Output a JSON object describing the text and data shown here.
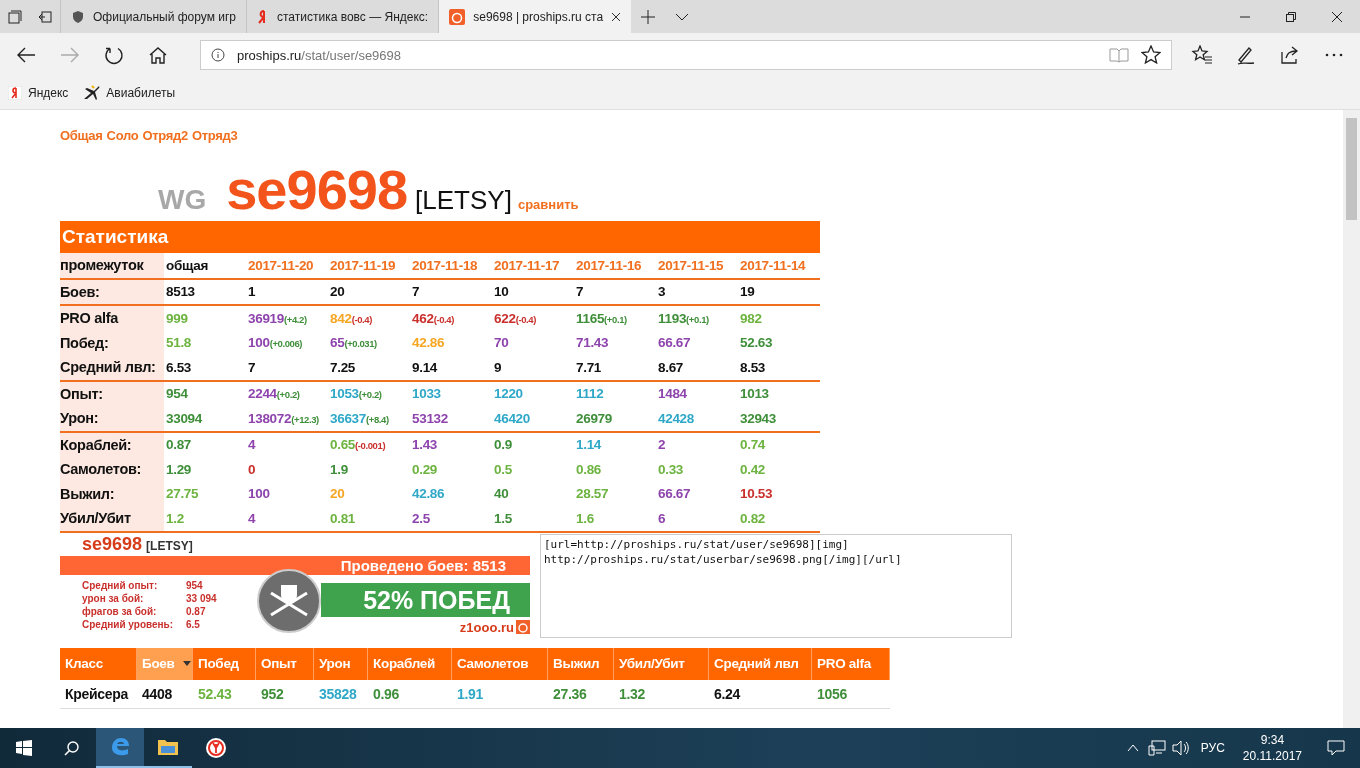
{
  "browser": {
    "tabs": [
      {
        "title": "Официальный форум игр",
        "selected": false
      },
      {
        "title": "статистика вовс — Яндекс:",
        "selected": false
      },
      {
        "title": "se9698 | proships.ru ста",
        "selected": true
      }
    ],
    "address": {
      "host": "proships.ru",
      "path": "/stat/user/se9698"
    },
    "bookmarks": [
      {
        "label": "Яндекс"
      },
      {
        "label": "Авиабилеты"
      }
    ]
  },
  "modes": [
    "Общая",
    "Соло",
    "Отряд2",
    "Отряд3"
  ],
  "player": {
    "prefix": "WG",
    "name": "se9698",
    "clan": "[LETSY]",
    "compare": "сравнить"
  },
  "stats": {
    "title": "Статистика",
    "header_label": "промежуток",
    "columns": [
      {
        "text": "общая",
        "color": "#111111"
      },
      {
        "text": "2017-11-20",
        "color": "#f07020"
      },
      {
        "text": "2017-11-19",
        "color": "#f07020"
      },
      {
        "text": "2017-11-18",
        "color": "#f07020"
      },
      {
        "text": "2017-11-17",
        "color": "#f07020"
      },
      {
        "text": "2017-11-16",
        "color": "#f07020"
      },
      {
        "text": "2017-11-15",
        "color": "#f07020"
      },
      {
        "text": "2017-11-14",
        "color": "#f07020"
      }
    ],
    "groups": [
      {
        "rows": [
          {
            "label": "Боев:",
            "cells": [
              {
                "value": "8513",
                "color": "#111111"
              },
              {
                "value": "1",
                "color": "#111111"
              },
              {
                "value": "20",
                "color": "#111111"
              },
              {
                "value": "7",
                "color": "#111111"
              },
              {
                "value": "10",
                "color": "#111111"
              },
              {
                "value": "7",
                "color": "#111111"
              },
              {
                "value": "3",
                "color": "#111111"
              },
              {
                "value": "19",
                "color": "#111111"
              }
            ]
          }
        ]
      },
      {
        "rows": [
          {
            "label": "PRO alfa",
            "cells": [
              {
                "value": "999",
                "color": "#6cb33f"
              },
              {
                "value": "36919",
                "color": "#8e44ad",
                "delta": {
                  "text": "(+4.2)",
                  "color": "#3f8f3a"
                }
              },
              {
                "value": "842",
                "color": "#f5a623",
                "delta": {
                  "text": "(-0.4)",
                  "color": "#c9302c"
                }
              },
              {
                "value": "462",
                "color": "#c9302c",
                "delta": {
                  "text": "(-0.4)",
                  "color": "#c9302c"
                }
              },
              {
                "value": "622",
                "color": "#c9302c",
                "delta": {
                  "text": "(-0.4)",
                  "color": "#c9302c"
                }
              },
              {
                "value": "1165",
                "color": "#3f8f3a",
                "delta": {
                  "text": "(+0.1)",
                  "color": "#3f8f3a"
                }
              },
              {
                "value": "1193",
                "color": "#3f8f3a",
                "delta": {
                  "text": "(+0.1)",
                  "color": "#3f8f3a"
                }
              },
              {
                "value": "982",
                "color": "#6cb33f"
              }
            ]
          },
          {
            "label": "Побед:",
            "cells": [
              {
                "value": "51.8",
                "color": "#6cb33f"
              },
              {
                "value": "100",
                "color": "#8e44ad",
                "delta": {
                  "text": "(+0.006)",
                  "color": "#3f8f3a"
                }
              },
              {
                "value": "65",
                "color": "#8e44ad",
                "delta": {
                  "text": "(+0.031)",
                  "color": "#3f8f3a"
                }
              },
              {
                "value": "42.86",
                "color": "#f5a623"
              },
              {
                "value": "70",
                "color": "#8e44ad"
              },
              {
                "value": "71.43",
                "color": "#8e44ad"
              },
              {
                "value": "66.67",
                "color": "#8e44ad"
              },
              {
                "value": "52.63",
                "color": "#3f8f3a"
              }
            ]
          },
          {
            "label": "Средний лвл:",
            "cells": [
              {
                "value": "6.53",
                "color": "#111111"
              },
              {
                "value": "7",
                "color": "#111111"
              },
              {
                "value": "7.25",
                "color": "#111111"
              },
              {
                "value": "9.14",
                "color": "#111111"
              },
              {
                "value": "9",
                "color": "#111111"
              },
              {
                "value": "7.71",
                "color": "#111111"
              },
              {
                "value": "8.67",
                "color": "#111111"
              },
              {
                "value": "8.53",
                "color": "#111111"
              }
            ]
          }
        ]
      },
      {
        "rows": [
          {
            "label": "Опыт:",
            "cells": [
              {
                "value": "954",
                "color": "#3f8f3a"
              },
              {
                "value": "2244",
                "color": "#8e44ad",
                "delta": {
                  "text": "(+0.2)",
                  "color": "#3f8f3a"
                }
              },
              {
                "value": "1053",
                "color": "#2fa8c8",
                "delta": {
                  "text": "(+0.2)",
                  "color": "#3f8f3a"
                }
              },
              {
                "value": "1033",
                "color": "#2fa8c8"
              },
              {
                "value": "1220",
                "color": "#2fa8c8"
              },
              {
                "value": "1112",
                "color": "#2fa8c8"
              },
              {
                "value": "1484",
                "color": "#8e44ad"
              },
              {
                "value": "1013",
                "color": "#3f8f3a"
              }
            ]
          },
          {
            "label": "Урон:",
            "cells": [
              {
                "value": "33094",
                "color": "#3f8f3a"
              },
              {
                "value": "138072",
                "color": "#8e44ad",
                "delta": {
                  "text": "(+12.3)",
                  "color": "#3f8f3a"
                }
              },
              {
                "value": "36637",
                "color": "#2fa8c8",
                "delta": {
                  "text": "(+8.4)",
                  "color": "#3f8f3a"
                }
              },
              {
                "value": "53132",
                "color": "#8e44ad"
              },
              {
                "value": "46420",
                "color": "#2fa8c8"
              },
              {
                "value": "26979",
                "color": "#3f8f3a"
              },
              {
                "value": "42428",
                "color": "#2fa8c8"
              },
              {
                "value": "32943",
                "color": "#3f8f3a"
              }
            ]
          }
        ]
      },
      {
        "rows": [
          {
            "label": "Кораблей:",
            "cells": [
              {
                "value": "0.87",
                "color": "#3f8f3a"
              },
              {
                "value": "4",
                "color": "#8e44ad"
              },
              {
                "value": "0.65",
                "color": "#6cb33f",
                "delta": {
                  "text": "(-0.001)",
                  "color": "#c9302c"
                }
              },
              {
                "value": "1.43",
                "color": "#8e44ad"
              },
              {
                "value": "0.9",
                "color": "#3f8f3a"
              },
              {
                "value": "1.14",
                "color": "#2fa8c8"
              },
              {
                "value": "2",
                "color": "#8e44ad"
              },
              {
                "value": "0.74",
                "color": "#6cb33f"
              }
            ]
          },
          {
            "label": "Самолетов:",
            "cells": [
              {
                "value": "1.29",
                "color": "#3f8f3a"
              },
              {
                "value": "0",
                "color": "#c9302c"
              },
              {
                "value": "1.9",
                "color": "#3f8f3a"
              },
              {
                "value": "0.29",
                "color": "#6cb33f"
              },
              {
                "value": "0.5",
                "color": "#6cb33f"
              },
              {
                "value": "0.86",
                "color": "#6cb33f"
              },
              {
                "value": "0.33",
                "color": "#6cb33f"
              },
              {
                "value": "0.42",
                "color": "#6cb33f"
              }
            ]
          },
          {
            "label": "Выжил:",
            "cells": [
              {
                "value": "27.75",
                "color": "#6cb33f"
              },
              {
                "value": "100",
                "color": "#8e44ad"
              },
              {
                "value": "20",
                "color": "#f5a623"
              },
              {
                "value": "42.86",
                "color": "#2fa8c8"
              },
              {
                "value": "40",
                "color": "#3f8f3a"
              },
              {
                "value": "28.57",
                "color": "#6cb33f"
              },
              {
                "value": "66.67",
                "color": "#8e44ad"
              },
              {
                "value": "10.53",
                "color": "#c9302c"
              }
            ]
          },
          {
            "label": "Убил/Убит",
            "cells": [
              {
                "value": "1.2",
                "color": "#6cb33f"
              },
              {
                "value": "4",
                "color": "#8e44ad"
              },
              {
                "value": "0.81",
                "color": "#6cb33f"
              },
              {
                "value": "2.5",
                "color": "#8e44ad"
              },
              {
                "value": "1.5",
                "color": "#3f8f3a"
              },
              {
                "value": "1.6",
                "color": "#6cb33f"
              },
              {
                "value": "6",
                "color": "#8e44ad"
              },
              {
                "value": "0.82",
                "color": "#6cb33f"
              }
            ]
          }
        ]
      }
    ]
  },
  "userbar": {
    "name": "se9698",
    "clan": "[LETSY]",
    "battles": "Проведено боев: 8513",
    "lines": [
      {
        "label": "Средний опыт:",
        "value": "954"
      },
      {
        "label": "урон за бой:",
        "value": "33 094"
      },
      {
        "label": "фрагов за бой:",
        "value": "0.87"
      },
      {
        "label": "Средний уровень:",
        "value": "6.5"
      }
    ],
    "wins": "52% ПОБЕД",
    "site": "z1ooo.ru"
  },
  "bbcode": "[url=http://proships.ru/stat/user/se9698][img]\nhttp://proships.ru/stat/userbar/se9698.png[/img][/url]",
  "classes": {
    "columns": [
      {
        "label": "Класс",
        "selected": false
      },
      {
        "label": "Боев",
        "selected": true
      },
      {
        "label": "Побед",
        "selected": false
      },
      {
        "label": "Опыт",
        "selected": false
      },
      {
        "label": "Урон",
        "selected": false
      },
      {
        "label": "Кораблей",
        "selected": false
      },
      {
        "label": "Самолетов",
        "selected": false
      },
      {
        "label": "Выжил",
        "selected": false
      },
      {
        "label": "Убил/Убит",
        "selected": false
      },
      {
        "label": "Средний лвл",
        "selected": false
      },
      {
        "label": "PRO alfa",
        "selected": false
      }
    ],
    "rows": [
      {
        "cells": [
          {
            "value": "Крейсера",
            "color": "#111111"
          },
          {
            "value": "4408",
            "color": "#111111"
          },
          {
            "value": "52.43",
            "color": "#6cb33f"
          },
          {
            "value": "952",
            "color": "#3f8f3a"
          },
          {
            "value": "35828",
            "color": "#2fa8c8"
          },
          {
            "value": "0.96",
            "color": "#3f8f3a"
          },
          {
            "value": "1.91",
            "color": "#2fa8c8"
          },
          {
            "value": "27.36",
            "color": "#3f8f3a"
          },
          {
            "value": "1.32",
            "color": "#3f8f3a"
          },
          {
            "value": "6.24",
            "color": "#111111"
          },
          {
            "value": "1056",
            "color": "#3f8f3a"
          }
        ]
      }
    ]
  },
  "taskbar": {
    "language": "РУС",
    "time": "9:34",
    "date": "20.11.2017"
  }
}
